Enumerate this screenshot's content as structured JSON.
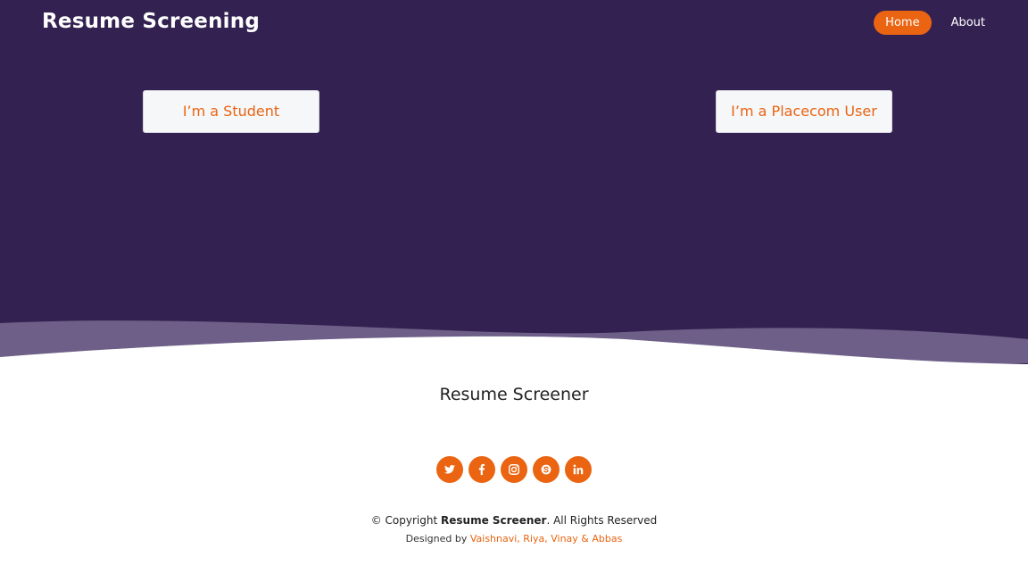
{
  "header": {
    "brand": "Resume Screening",
    "nav": [
      {
        "label": "Home",
        "active": true
      },
      {
        "label": "About",
        "active": false
      }
    ]
  },
  "hero": {
    "student_button": "I’m a Student",
    "placecom_button": "I’m a Placecom User"
  },
  "footer": {
    "title": "Resume Screener",
    "social_icons": [
      "twitter-icon",
      "facebook-icon",
      "instagram-icon",
      "skype-icon",
      "linkedin-icon"
    ],
    "copyright_prefix": "© Copyright",
    "copyright_name": "Resume Screener",
    "copyright_suffix": ". All Rights Reserved",
    "designed_by_prefix": "Designed by",
    "designers": "Vaishnavi, Riya, Vinay & Abbas"
  },
  "colors": {
    "hero_background": "#332251",
    "accent": "#ea6411",
    "wave_light": "#6e5f88",
    "button_background": "#f6f7f9"
  }
}
